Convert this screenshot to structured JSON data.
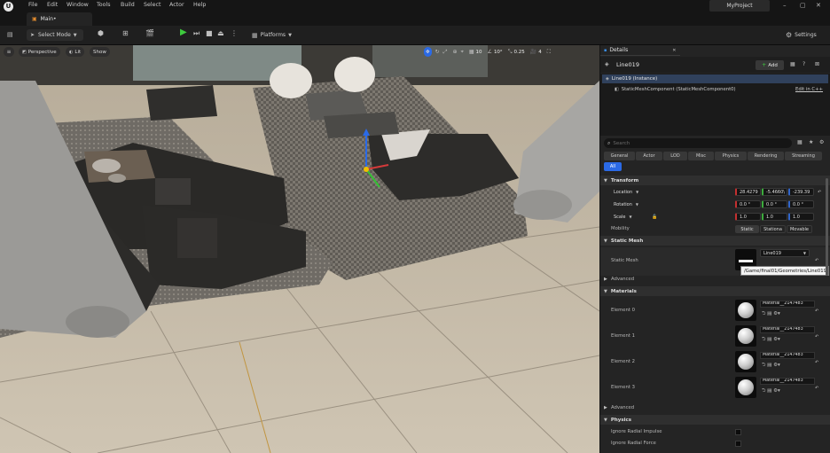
{
  "titlebar": {
    "menus": [
      "File",
      "Edit",
      "Window",
      "Tools",
      "Build",
      "Select",
      "Actor",
      "Help"
    ],
    "project": "MyProject"
  },
  "tab": {
    "label": "Main•"
  },
  "toolbar": {
    "mode": "Select Mode",
    "platforms": "Platforms",
    "settings": "Settings"
  },
  "viewport": {
    "perspective": "Perspective",
    "lit": "Lit",
    "show": "Show",
    "grid": "10",
    "angle": "10°",
    "scale": "0.25",
    "cams": "4"
  },
  "details": {
    "tab": "Details",
    "actor": "Line019",
    "add": "Add",
    "instance": "Line019 (Instance)",
    "component": "StaticMeshComponent (StaticMeshComponent0)",
    "edit_cpp": "Edit in C++",
    "search_placeholder": "Search",
    "categories": [
      "General",
      "Actor",
      "LOD",
      "Misc",
      "Physics",
      "Rendering",
      "Streaming",
      "All"
    ],
    "transform": {
      "title": "Transform",
      "location_label": "Location",
      "location": [
        "28.4279",
        "-5.4660\\",
        "-239.39"
      ],
      "rotation_label": "Rotation",
      "rotation": [
        "0.0 °",
        "0.0 °",
        "0.0 °"
      ],
      "scale_label": "Scale",
      "scale": [
        "1.0",
        "1.0",
        "1.0"
      ],
      "mobility_label": "Mobility",
      "mobility": [
        "Static",
        "Stationa",
        "Movable"
      ]
    },
    "static_mesh": {
      "title": "Static Mesh",
      "label": "Static Mesh",
      "value": "Line019",
      "tooltip": "/Game/final01/Geometries/Line019",
      "advanced": "Advanced"
    },
    "materials": {
      "title": "Materials",
      "elements": [
        {
          "label": "Element 0",
          "value": "Material__2147483"
        },
        {
          "label": "Element 1",
          "value": "Material__2147483"
        },
        {
          "label": "Element 2",
          "value": "Material__2147483"
        },
        {
          "label": "Element 3",
          "value": "Material__2147483"
        }
      ],
      "advanced": "Advanced"
    },
    "physics": {
      "title": "Physics",
      "rows": [
        "Ignore Radial Impulse",
        "Ignore Radial Force"
      ]
    }
  }
}
